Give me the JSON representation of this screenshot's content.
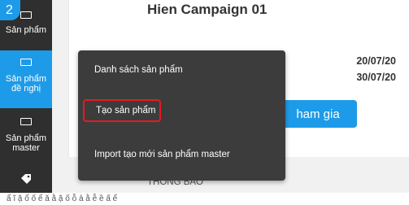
{
  "badge_number": "2",
  "sidebar": {
    "items": [
      {
        "label": "Sản phẩm"
      },
      {
        "label_line1": "Sản phẩm",
        "label_line2": "đề nghị"
      },
      {
        "label_line1": "Sản phẩm",
        "label_line2": "master"
      }
    ],
    "tag_icon": "tag-icon"
  },
  "main": {
    "campaign_title": "Hien Campaign 01",
    "date_start": "20/07/20",
    "date_end": "30/07/20",
    "join_button": "ham gia",
    "section_label": "THÔNG BÁO",
    "bottom_text": "ẩ ĩ ặ ổ ố ể ă ằ ặ ố ỗ ả ằ ễ ề ấ ể"
  },
  "dropdown": {
    "items": [
      {
        "label": "Danh sách sản phẩm"
      },
      {
        "label": "Tạo sản phẩm"
      },
      {
        "label": "Import tạo mới sản phẩm master"
      }
    ]
  },
  "colors": {
    "accent": "#1e9be8",
    "sidebar_bg": "#2f2f2f",
    "dropdown_bg": "#3c3c3c",
    "highlight": "#e31b23"
  }
}
